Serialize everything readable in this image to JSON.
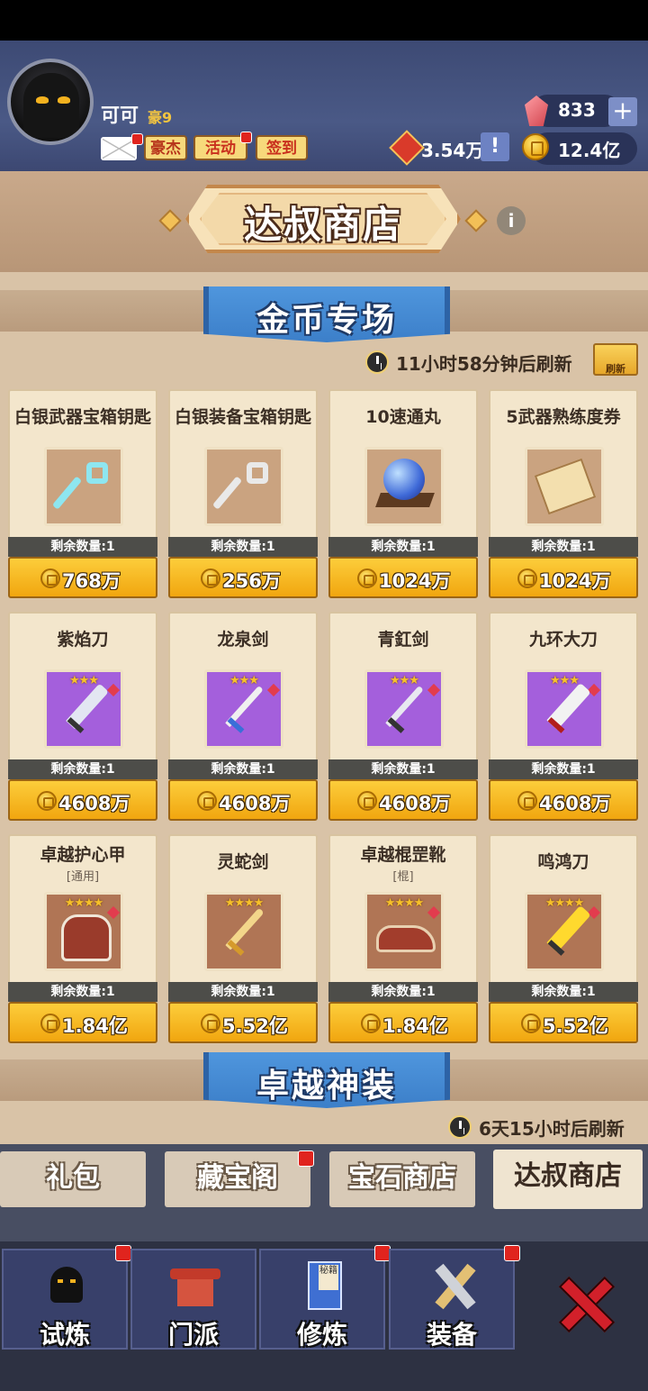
{
  "player": {
    "name": "可可",
    "vip": "豪9"
  },
  "top_buttons": {
    "hero": "豪杰",
    "event": "活动",
    "signin": "签到"
  },
  "resources": {
    "gems": "833",
    "honor": "3.54万",
    "coins": "12.4亿"
  },
  "shop": {
    "title": "达叔商店"
  },
  "section1": {
    "title": "金币专场",
    "refresh_timer": "11小时58分钟后刷新",
    "refresh_label": "刷新"
  },
  "items": [
    {
      "name": "白银武器宝箱钥匙",
      "tag": "",
      "stars": "",
      "stock": "剩余数量:1",
      "price": "768万"
    },
    {
      "name": "白银装备宝箱钥匙",
      "tag": "",
      "stars": "",
      "stock": "剩余数量:1",
      "price": "256万"
    },
    {
      "name": "10速通丸",
      "tag": "",
      "stars": "",
      "stock": "剩余数量:1",
      "price": "1024万"
    },
    {
      "name": "5武器熟练度券",
      "tag": "",
      "stars": "",
      "stock": "剩余数量:1",
      "price": "1024万"
    },
    {
      "name": "紫焰刀",
      "tag": "",
      "stars": "★★★",
      "stock": "剩余数量:1",
      "price": "4608万"
    },
    {
      "name": "龙泉剑",
      "tag": "",
      "stars": "★★★",
      "stock": "剩余数量:1",
      "price": "4608万"
    },
    {
      "name": "青釭剑",
      "tag": "",
      "stars": "★★★",
      "stock": "剩余数量:1",
      "price": "4608万"
    },
    {
      "name": "九环大刀",
      "tag": "",
      "stars": "★★★",
      "stock": "剩余数量:1",
      "price": "4608万"
    },
    {
      "name": "卓越护心甲",
      "tag": "[通用]",
      "stars": "★★★★",
      "stock": "剩余数量:1",
      "price": "1.84亿"
    },
    {
      "name": "灵蛇剑",
      "tag": "",
      "stars": "★★★★",
      "stock": "剩余数量:1",
      "price": "5.52亿"
    },
    {
      "name": "卓越棍罡靴",
      "tag": "[棍]",
      "stars": "★★★★",
      "stock": "剩余数量:1",
      "price": "1.84亿"
    },
    {
      "name": "鸣鸿刀",
      "tag": "",
      "stars": "★★★★",
      "stock": "剩余数量:1",
      "price": "5.52亿"
    }
  ],
  "section2": {
    "title": "卓越神装",
    "refresh_timer": "6天15小时后刷新"
  },
  "shop_tabs": [
    "礼包",
    "藏宝阁",
    "宝石商店",
    "达叔商店"
  ],
  "nav": [
    "试炼",
    "门派",
    "修炼",
    "装备"
  ],
  "nav_book_label": "秘籍",
  "colors": {
    "accent_gold": "#f1a60f",
    "ribbon_blue": "#3c7fc9",
    "badge_red": "#e0241e",
    "purple_rarity": "#a45fdc"
  }
}
